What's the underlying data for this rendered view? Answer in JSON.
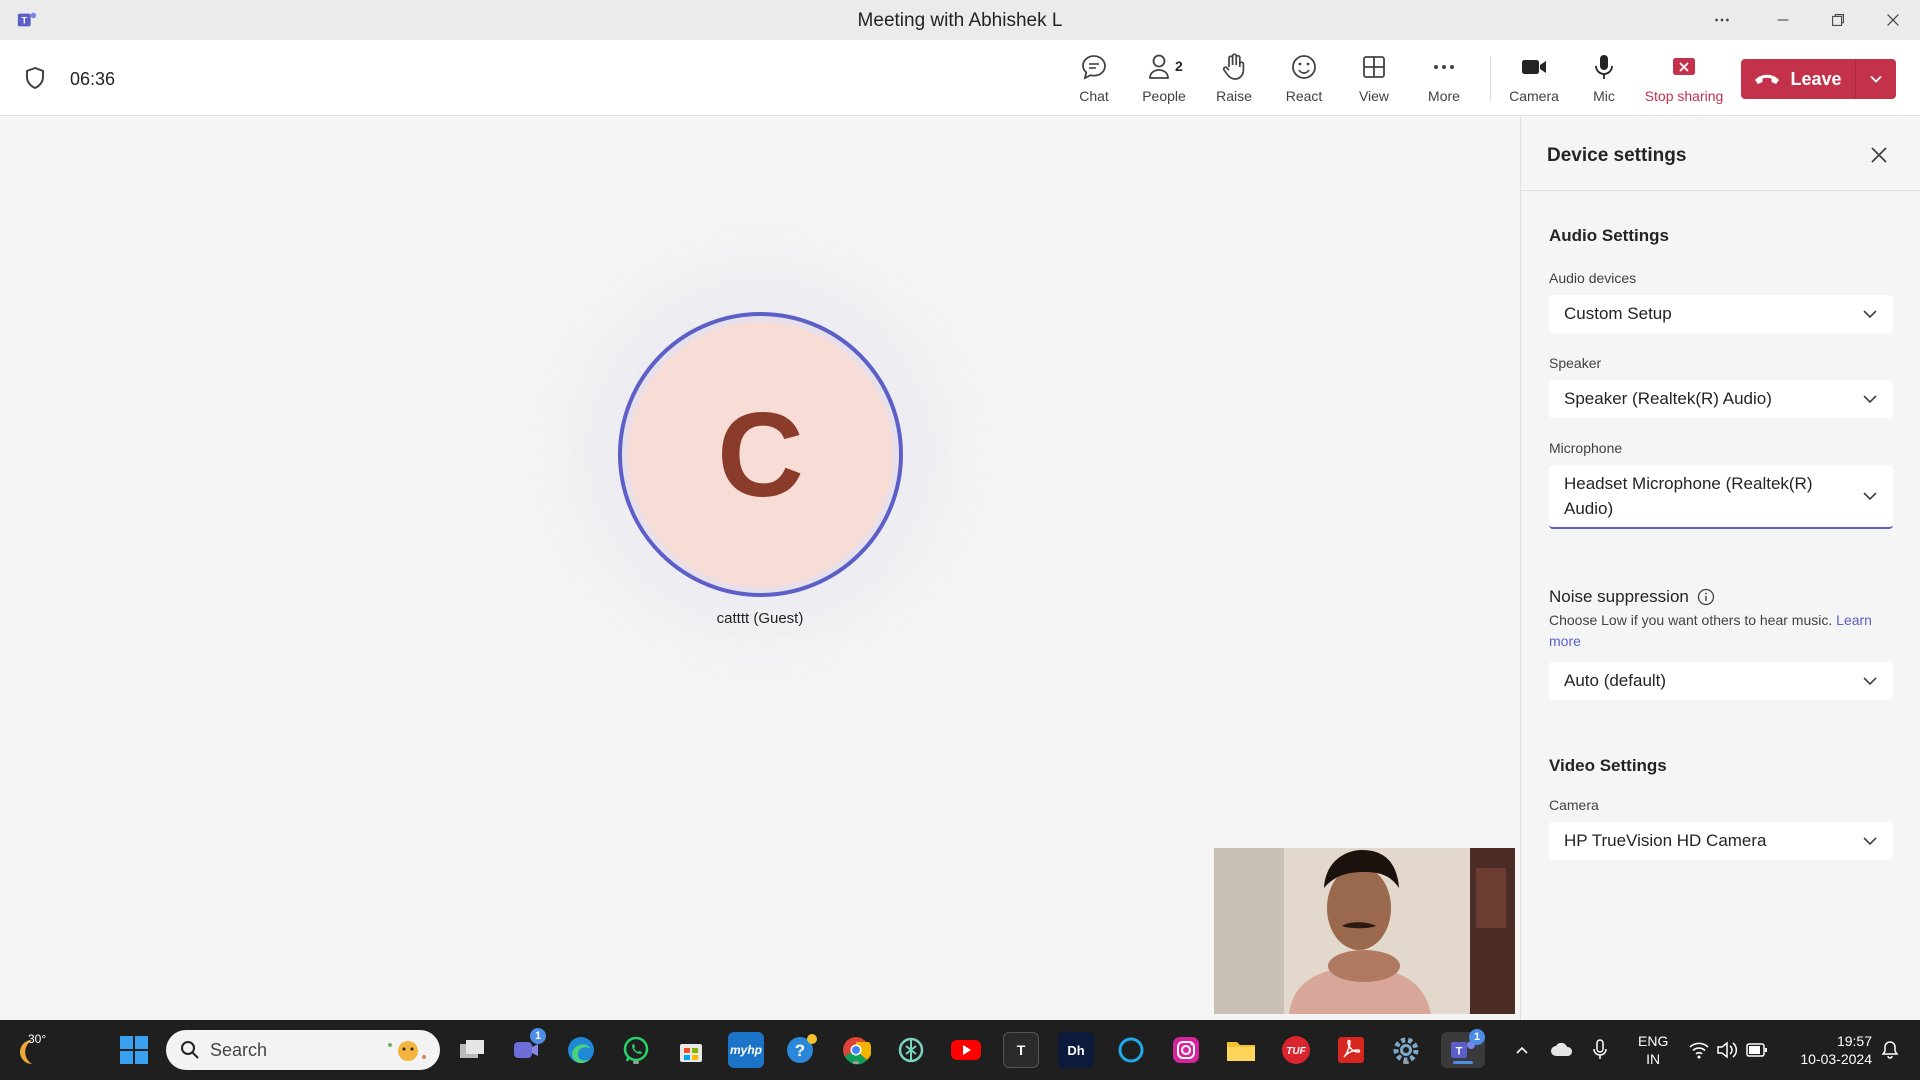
{
  "window": {
    "title": "Meeting with Abhishek L"
  },
  "meeting": {
    "timer": "06:36",
    "people_count": "2",
    "tools": {
      "chat": "Chat",
      "people": "People",
      "raise": "Raise",
      "react": "React",
      "view": "View",
      "more": "More",
      "camera": "Camera",
      "mic": "Mic",
      "stop_sharing": "Stop sharing"
    },
    "leave_label": "Leave"
  },
  "stage": {
    "avatar_initial": "C",
    "participant_name": "catttt (Guest)"
  },
  "panel": {
    "title": "Device settings",
    "audio_section": "Audio Settings",
    "audio_devices_label": "Audio devices",
    "audio_devices_value": "Custom Setup",
    "speaker_label": "Speaker",
    "speaker_value": "Speaker (Realtek(R) Audio)",
    "microphone_label": "Microphone",
    "microphone_value": "Headset Microphone (Realtek(R) Audio)",
    "noise_label": "Noise suppression",
    "noise_desc": "Choose Low if you want others to hear music.",
    "noise_link": "Learn more",
    "noise_value": "Auto (default)",
    "video_section": "Video Settings",
    "camera_label": "Camera",
    "camera_value": "HP TrueVision HD Camera"
  },
  "taskbar": {
    "weather_temp": "30°",
    "search_placeholder": "Search",
    "meet_badge": "1",
    "teams_badge": "1",
    "lang_top": "ENG",
    "lang_bottom": "IN",
    "time": "19:57",
    "date": "10-03-2024"
  },
  "colors": {
    "accent": "#5b5fc7",
    "leave": "#c4314b",
    "avatar_bg": "#f8dcd6",
    "avatar_text": "#8a3b2a"
  }
}
